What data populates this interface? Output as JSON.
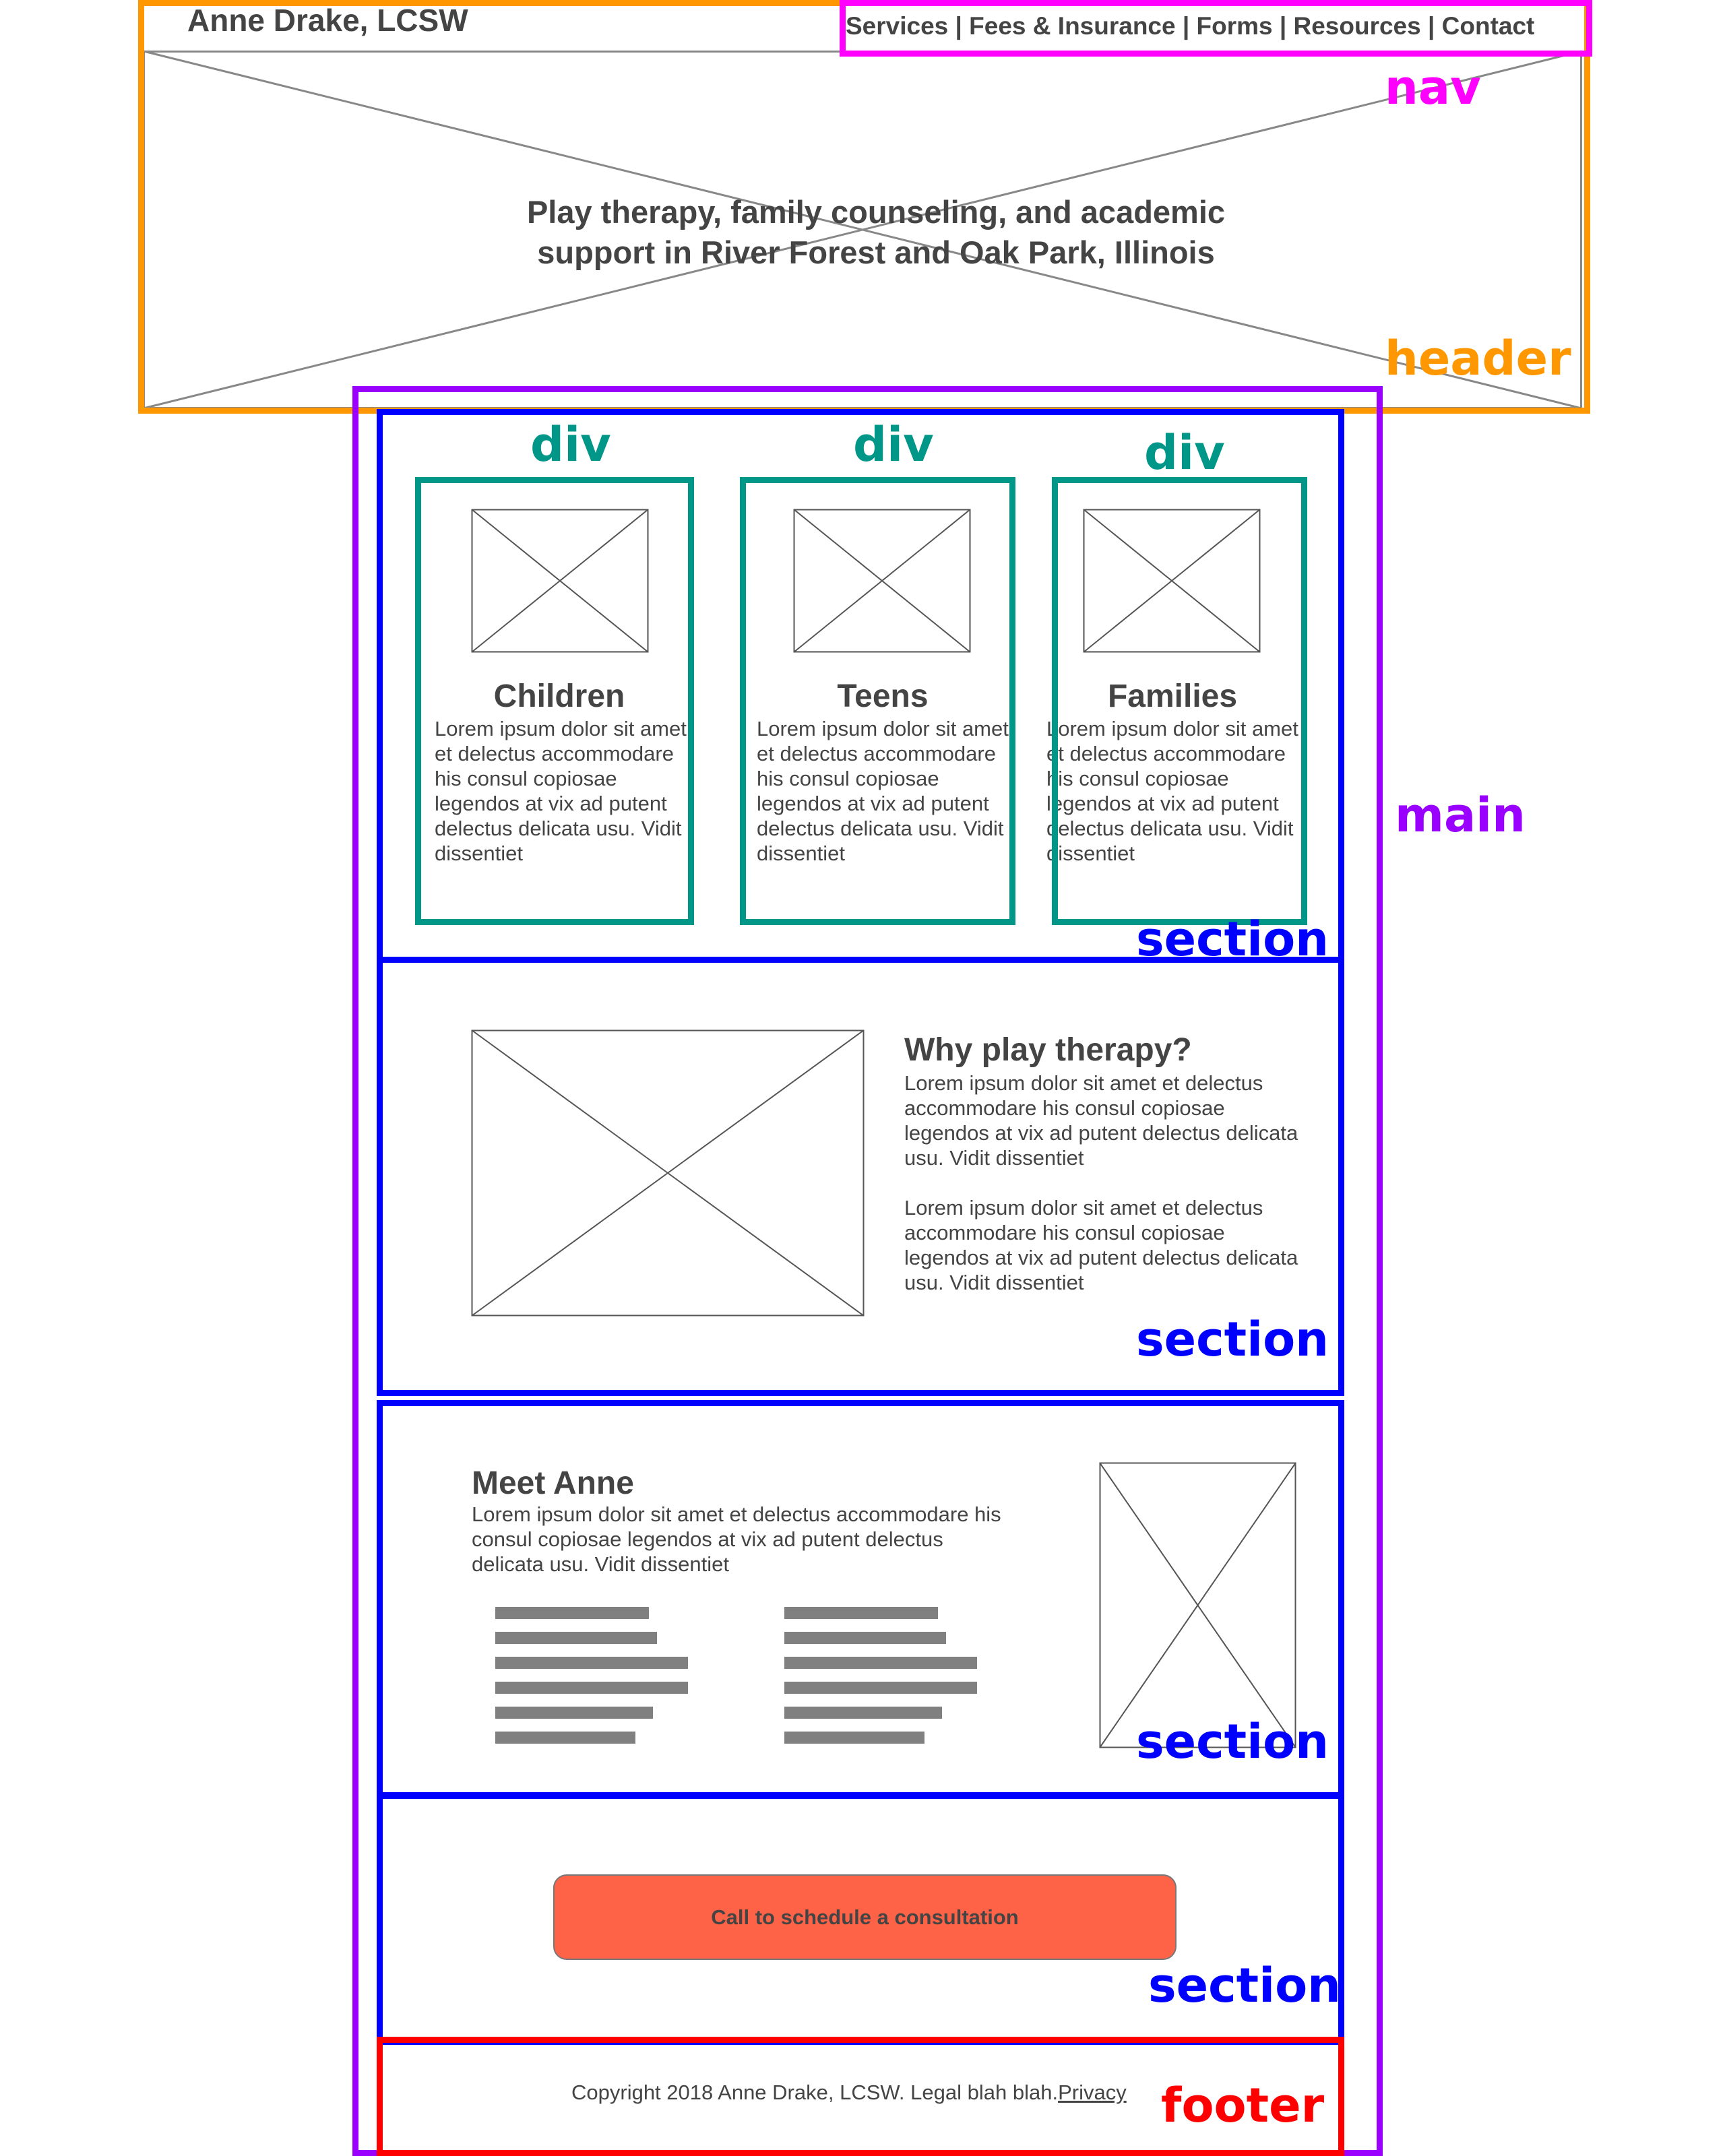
{
  "header": {
    "site_title": "Anne Drake, LCSW",
    "nav_links": [
      "Services",
      "Fees & Insurance",
      "Forms",
      "Resources",
      "Contact"
    ],
    "nav_separator": " | ",
    "hero_text": "Play therapy, family counseling, and academic support in River Forest and Oak Park, Illinois"
  },
  "cards": [
    {
      "title": "Children",
      "body": "Lorem ipsum dolor sit amet et delectus accommodare his consul copiosae legendos at vix ad putent delectus delicata usu. Vidit dissentiet"
    },
    {
      "title": "Teens",
      "body": "Lorem ipsum dolor sit amet et delectus accommodare his consul copiosae legendos at vix ad putent delectus delicata usu. Vidit dissentiet"
    },
    {
      "title": "Families",
      "body": "Lorem ipsum dolor sit amet et delectus accommodare his consul copiosae legendos at vix ad putent delectus delicata usu. Vidit dissentiet"
    }
  ],
  "why": {
    "title": "Why play therapy?",
    "paragraphs": [
      "Lorem ipsum dolor sit amet et delectus accommodare his consul copiosae legendos at vix ad putent delectus delicata usu. Vidit dissentiet",
      "Lorem ipsum dolor sit amet et delectus accommodare his consul copiosae legendos at vix ad putent delectus delicata usu. Vidit dissentiet"
    ]
  },
  "meet": {
    "title": "Meet Anne",
    "body": "Lorem ipsum dolor sit amet et delectus accommodare his consul copiosae legendos at vix ad putent delectus delicata usu. Vidit dissentiet"
  },
  "cta": {
    "label": "Call to schedule a consultation"
  },
  "footer": {
    "copyright": "Copyright 2018 Anne Drake, LCSW. Legal blah blah.",
    "privacy_link": "Privacy"
  },
  "outline_tags": {
    "header": "header",
    "nav": "nav",
    "main": "main",
    "section": "section",
    "div": "div",
    "footer": "footer"
  },
  "colors": {
    "header_outline": "#FF9800",
    "nav_outline": "#FF00FF",
    "main_outline": "#9900FF",
    "section_outline": "#0000FF",
    "div_outline": "#009688",
    "footer_outline": "#FF0000",
    "cta_fill": "#FF6347",
    "wireframe_text": "#444444",
    "placeholder_bar": "#808080"
  }
}
